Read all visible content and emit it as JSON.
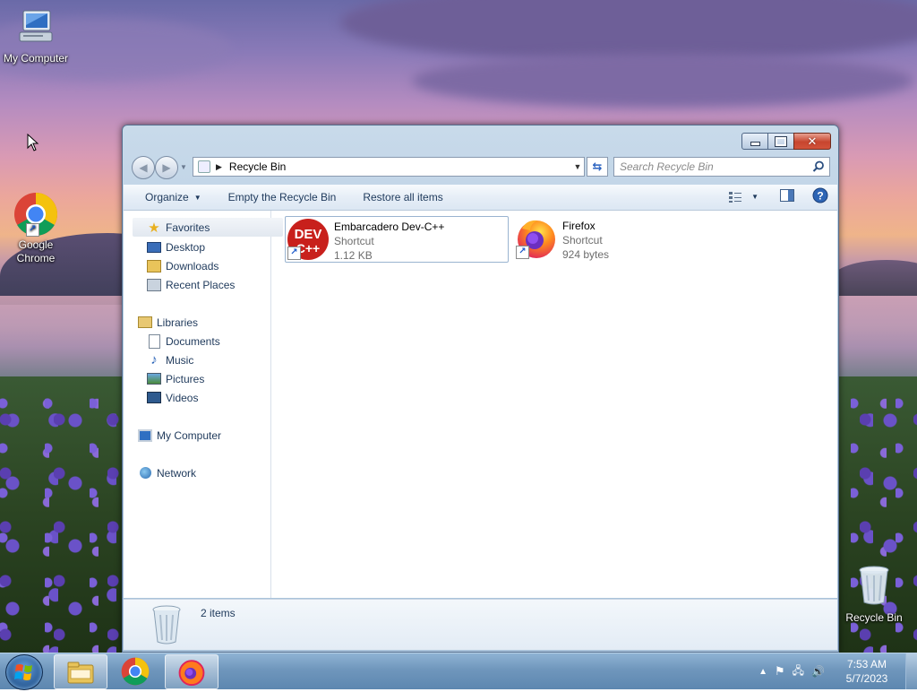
{
  "desktop": {
    "icons": [
      {
        "label": "My Computer",
        "icon": "computer-icon"
      },
      {
        "label": "Google Chrome",
        "icon": "chrome-icon"
      },
      {
        "label": "Recycle Bin",
        "icon": "recycle-bin-icon"
      }
    ]
  },
  "window": {
    "address": "Recycle Bin",
    "search_placeholder": "Search Recycle Bin",
    "toolbar": {
      "organize": "Organize",
      "empty": "Empty the Recycle Bin",
      "restore": "Restore all items"
    },
    "nav": {
      "favorites": "Favorites",
      "desktop": "Desktop",
      "downloads": "Downloads",
      "recent": "Recent Places",
      "libraries": "Libraries",
      "documents": "Documents",
      "music": "Music",
      "pictures": "Pictures",
      "videos": "Videos",
      "computer": "My Computer",
      "network": "Network"
    },
    "files": [
      {
        "name": "Embarcadero Dev-C++",
        "type": "Shortcut",
        "size": "1.12 KB",
        "icon_text": "DEV C++"
      },
      {
        "name": "Firefox",
        "type": "Shortcut",
        "size": "924 bytes"
      }
    ],
    "details": {
      "count": "2 items"
    }
  },
  "taskbar": {
    "apps": [
      "explorer-icon",
      "chrome-icon",
      "firefox-icon"
    ],
    "time": "7:53 AM",
    "date": "5/7/2023"
  },
  "colors": {
    "accent": "#1e395b",
    "selection_border": "#9ab4d0",
    "close_red": "#c7452e"
  }
}
